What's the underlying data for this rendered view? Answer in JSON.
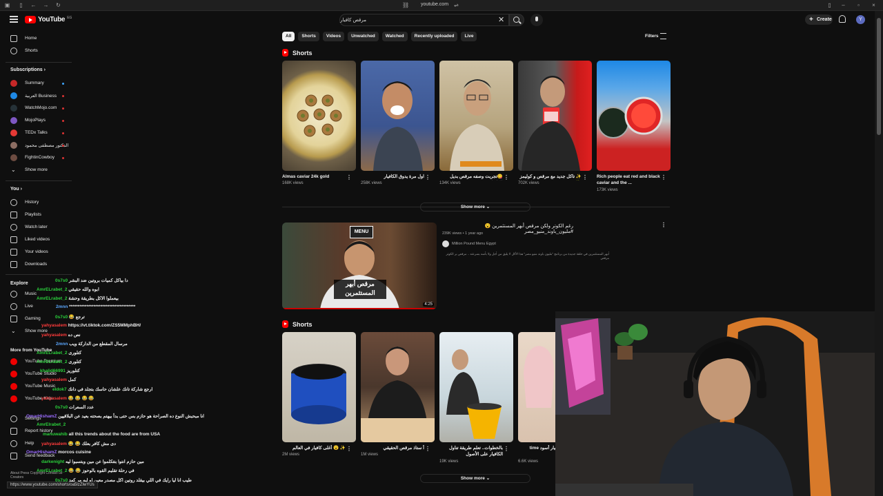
{
  "browser": {
    "url": "youtube.com"
  },
  "header": {
    "logo_text": "YouTube",
    "logo_sup": "EG",
    "search_value": "مرقص كافيار",
    "create_label": "Create",
    "avatar_letter": "Y"
  },
  "sidebar": {
    "main": [
      {
        "label": "Home",
        "icon": "home-icon"
      },
      {
        "label": "Shorts",
        "icon": "shorts-icon"
      }
    ],
    "subscriptions_heading": "Subscriptions",
    "subscriptions": [
      {
        "label": "Summary",
        "color": "#c62828",
        "dot": "#3ea6ff"
      },
      {
        "label": "العربية Business",
        "color": "#1e88e5"
      },
      {
        "label": "WatchMojo.com",
        "color": "#212121"
      },
      {
        "label": "MojoPlays",
        "color": "#7e57c2"
      },
      {
        "label": "TEDx Talks",
        "color": "#e53935"
      },
      {
        "label": "الدكتور مصطفى محمود",
        "color": "#8d6e63"
      },
      {
        "label": "FightinCowboy",
        "color": "#6d4c41"
      },
      {
        "label": "Show more",
        "color": ""
      }
    ],
    "you_heading": "You",
    "you": [
      {
        "label": "History"
      },
      {
        "label": "Playlists"
      },
      {
        "label": "Watch later"
      },
      {
        "label": "Liked videos"
      },
      {
        "label": "Your videos"
      },
      {
        "label": "Downloads"
      }
    ],
    "explore_heading": "Explore",
    "explore": [
      {
        "label": "Music"
      },
      {
        "label": "Live"
      },
      {
        "label": "Gaming"
      },
      {
        "label": "Show more"
      }
    ],
    "more_heading": "More from YouTube",
    "more": [
      {
        "label": "YouTube Premium"
      },
      {
        "label": "YouTube Studio"
      },
      {
        "label": "YouTube Music"
      },
      {
        "label": "YouTube Kids"
      }
    ],
    "settings": [
      {
        "label": "Settings"
      },
      {
        "label": "Report history"
      },
      {
        "label": "Help"
      },
      {
        "label": "Send feedback"
      }
    ],
    "footer": "About  Press  Copyright  Contact us  Creators"
  },
  "chips": [
    "All",
    "Shorts",
    "Videos",
    "Unwatched",
    "Watched",
    "Recently uploaded",
    "Live"
  ],
  "filters_label": "Filters",
  "shorts_heading": "Shorts",
  "shorts_row1": [
    {
      "title": "Almas caviar 24k gold",
      "views": "168K views",
      "rtl": false
    },
    {
      "title": "اول مرة يدوق الكافيار",
      "views": "258K views",
      "rtl": true
    },
    {
      "title": "😋تجربت وصفه مرقص بديل الكافيار",
      "views": "134K views",
      "rtl": true
    },
    {
      "title": "✨ تاكل جديد مع مرقص و كوليمز 🍓",
      "views": "702K views",
      "rtl": true
    },
    {
      "title": "Rich people eat red and black caviar and the ...",
      "views": "173K views",
      "rtl": false
    }
  ],
  "show_more": "Show more",
  "video": {
    "title": "رغم الكوتر ولكن مرقص أبهر المستثمرين 😮 #مليون_باوند_منيو_مصر",
    "meta": "239K views • 1 year ago",
    "channel": "Million Pound Menu Egypt",
    "desc": "أبهر المستثمرين في حلقة جديدة من برنامج \"مليون باوند منيو مصر\" هذا الأكل لا يليق من أجل ولا بأسه بسرعته .. مرقص بر الكوتر مرقص",
    "duration": "4:25",
    "thumb_badge": "MENU",
    "thumb_caption": "مرقص أبهر المستثمرين"
  },
  "shorts_row2": [
    {
      "title": "✨ 😮 أغلى كافيار في العالم",
      "views": "2M views",
      "rtl": true
    },
    {
      "title": "أ ستاذ مرقص الحقيقي",
      "views": "1M views",
      "rtl": true
    },
    {
      "title": "بالخطوات.. تعلم طريقة تناول الكافيار على الأصول",
      "views": "19K views",
      "rtl": true
    },
    {
      "title": "مرة أجرب كافيار أسود time trying Black",
      "views": "6.6K views",
      "rtl": true
    }
  ],
  "chat": [
    {
      "name": "0s7s0",
      "msg": "دا بياكل كميات بروتين ضد البشر",
      "c": "chat-name"
    },
    {
      "name": "AmrELrabet_2",
      "msg": "ابوه والله حقيقي",
      "c": "chat-name"
    },
    {
      "name": "AmrELrabet_2",
      "msg": "بيعملوا الاكل بطريقة وحشة",
      "c": "chat-name"
    },
    {
      "name": "2mnn",
      "msg": "**************************************",
      "c": "chat-name blue"
    },
    {
      "name": "0s7s0",
      "msg": "😂 ترجع",
      "c": "chat-name"
    },
    {
      "name": "yahyasalem",
      "msg": "https://vt.tiktok.com/ZS5MMphBH/",
      "c": "chat-name red"
    },
    {
      "name": "yahyasalem",
      "msg": "نص ده",
      "c": "chat-name red"
    },
    {
      "name": "2mnn",
      "msg": "مرسال المقطع من الداركة ويب",
      "c": "chat-name blue"
    },
    {
      "name": "AmrELrabet_2",
      "msg": "كتلورى",
      "c": "chat-name"
    },
    {
      "name": "AmrELrabet_2",
      "msg": "كتلورى",
      "c": "chat-name"
    },
    {
      "name": "khalid66991",
      "msg": "كتلوريز",
      "c": "chat-name"
    },
    {
      "name": "yahyasalem",
      "msg": "كمل",
      "c": "chat-name red"
    },
    {
      "name": "eldok7",
      "msg": "ارجع شاركة تانك علشان حاسك بتجلد في دانك",
      "c": "chat-name"
    },
    {
      "name": "yahyasalem",
      "msg": "😂 😂 😂 😂",
      "c": "chat-name red"
    },
    {
      "name": "0s7s0",
      "msg": "عدد السعرات",
      "c": "chat-name"
    },
    {
      "name": "OmarHishamZ",
      "msg": "انا مبحبش النوع ده الصراحة هو حازم بس حتى بدأ بيهتم بصحته بعيد عن البلاقيين",
      "c": "chat-name mod"
    },
    {
      "name": "AmrElrabet_2",
      "msg": "",
      "c": "chat-name"
    },
    {
      "name": "manuwahib",
      "msg": "all this trends about the food are from USA",
      "c": "chat-name"
    },
    {
      "name": "yahyasalem",
      "msg": "😂 😂 دى مش كافر بعلك",
      "c": "chat-name red"
    },
    {
      "name": "OmarHishamZ",
      "msg": "morcos cuisine",
      "c": "chat-name mod"
    },
    {
      "name": "darkenight",
      "msg": "مين حازم انتوا بتتكلموا عن مين وبتسبوا ليه",
      "c": "chat-name"
    },
    {
      "name": "AmrELrabet_2",
      "msg": "😂 😂 في رحلة تقليم القوه بالوحوز",
      "c": "chat-name"
    },
    {
      "name": "0s7s0",
      "msg": "طيب انا ليا رايك في اللي بيقلد روتين اكل مصدر معين او ليه مر كهد",
      "c": "chat-name"
    }
  ],
  "status_url": "https://www.youtube.com/shorts/oa5lzZIwYUs"
}
